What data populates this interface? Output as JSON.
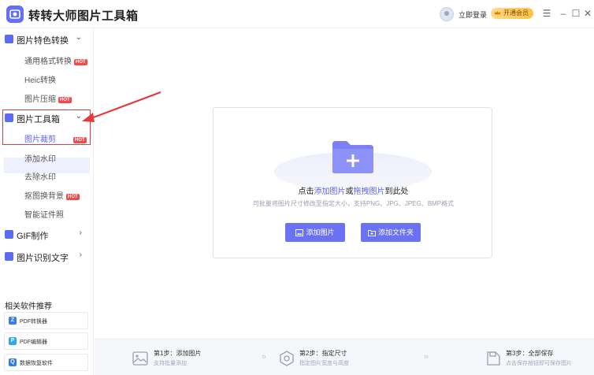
{
  "app": {
    "title": "转转大师图片工具箱"
  },
  "header": {
    "login_label": "立即登录",
    "vip_label": "开通会员",
    "menu_icon": "menu-icon",
    "minimize_icon": "minimize-icon",
    "maximize_icon": "maximize-icon",
    "close_icon": "close-icon"
  },
  "sidebar": {
    "groups": [
      {
        "label": "图片特色转换",
        "icon": "image-convert-icon",
        "expanded": true,
        "items": [
          {
            "label": "通用格式转换",
            "hot": "HOT"
          },
          {
            "label": "Heic转换"
          },
          {
            "label": "图片压缩",
            "hot": "HOT"
          }
        ]
      },
      {
        "label": "图片工具箱",
        "icon": "toolbox-icon",
        "expanded": true,
        "items": [
          {
            "label": "图片裁剪",
            "hot": "HOT",
            "active": true
          },
          {
            "label": "添加水印"
          },
          {
            "label": "去除水印"
          },
          {
            "label": "抠图换背景",
            "hot": "HOT"
          },
          {
            "label": "智能证件照"
          }
        ]
      },
      {
        "label": "GIF制作",
        "icon": "gif-icon",
        "expanded": false
      },
      {
        "label": "图片识别文字",
        "icon": "ocr-icon",
        "expanded": false
      }
    ],
    "related_title": "相关软件推荐",
    "related": [
      {
        "label": "PDF转换器",
        "icon": "pdf-converter-icon",
        "color": "#3b7bf0"
      },
      {
        "label": "PDF编辑器",
        "icon": "pdf-editor-icon",
        "color": "#2fa7f5"
      },
      {
        "label": "数据恢复软件",
        "icon": "data-recovery-icon",
        "color": "#2f7df0"
      }
    ]
  },
  "main": {
    "hint_prefix": "点击",
    "hint_link1": "添加图片",
    "hint_mid": "或",
    "hint_link2": "拖拽图片",
    "hint_suffix": "到此处",
    "sub_hint": "可批量将图片尺寸修改至指定大小，支持PNG、JPG、JPEG、BMP格式",
    "add_image_button": "添加图片",
    "add_folder_button": "添加文件夹"
  },
  "footer": {
    "steps": [
      {
        "title": "第1步：添加图片",
        "desc": "支持批量添加",
        "icon": "image-icon"
      },
      {
        "title": "第2步：指定尺寸",
        "desc": "指定图片宽度与高度",
        "icon": "settings-hex-icon"
      },
      {
        "title": "第3步：全部保存",
        "desc": "点击保存按钮即可保存图片",
        "icon": "save-icon"
      }
    ]
  },
  "colors": {
    "accent": "#6b71f3",
    "hot": "#f2494b",
    "annotation": "#e23b3b"
  }
}
